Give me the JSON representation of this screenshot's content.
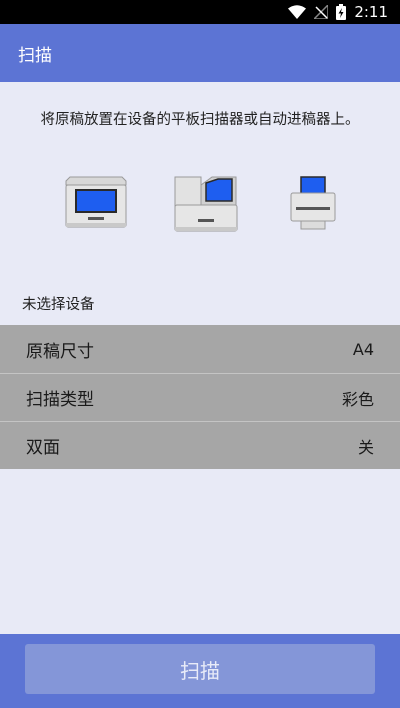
{
  "status_bar": {
    "time": "2:11",
    "icons": [
      "wifi-icon",
      "no-signal-icon",
      "battery-charging-icon"
    ]
  },
  "app_bar": {
    "title": "扫描"
  },
  "instruction": "将原稿放置在设备的平板扫描器或自动进稿器上。",
  "devices": [
    "flatbed-scanner-icon",
    "adf-scanner-icon",
    "printer-feeder-icon"
  ],
  "device_status": "未选择设备",
  "settings": [
    {
      "label": "原稿尺寸",
      "value": "A4"
    },
    {
      "label": "扫描类型",
      "value": "彩色"
    },
    {
      "label": "双面",
      "value": "关"
    }
  ],
  "scan_button": "扫描",
  "colors": {
    "accent": "#5c74d4",
    "background": "#e8eaf6",
    "settings_bg": "#a6a6a6",
    "button_disabled": "#8496d8"
  }
}
